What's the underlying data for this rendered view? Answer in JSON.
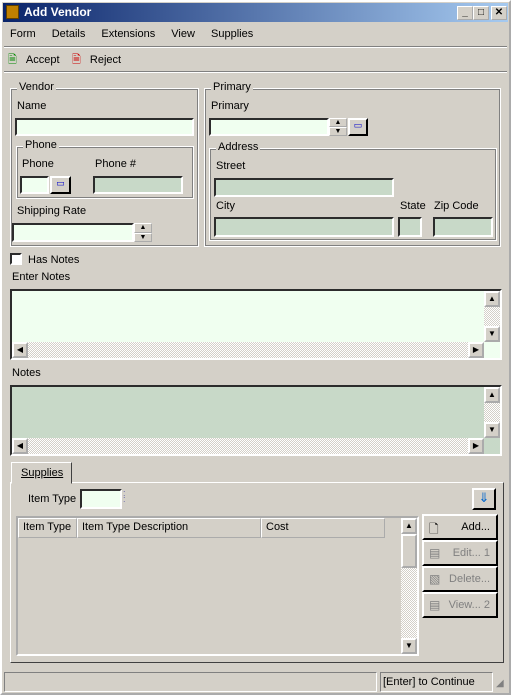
{
  "window": {
    "title": "Add Vendor",
    "min": "_",
    "max": "□",
    "close": "✕"
  },
  "menu": [
    "Form",
    "Details",
    "Extensions",
    "View",
    "Supplies"
  ],
  "toolbar": {
    "accept": "Accept",
    "reject": "Reject"
  },
  "vendor": {
    "group": "Vendor",
    "name_label": "Name",
    "name_value": "",
    "phone_group": "Phone",
    "phone_label": "Phone",
    "phone_num_label": "Phone #",
    "shipping_label": "Shipping Rate"
  },
  "primary": {
    "group": "Primary",
    "primary_label": "Primary",
    "address_group": "Address",
    "street_label": "Street",
    "city_label": "City",
    "state_label": "State",
    "zip_label": "Zip Code"
  },
  "notes": {
    "has_notes_label": "Has Notes",
    "has_notes_checked": false,
    "enter_label": "Enter Notes",
    "notes_label": "Notes"
  },
  "supplies": {
    "tab": "Supplies",
    "item_type_label": "Item Type",
    "columns": [
      "Item Type",
      "Item Type Description",
      "Cost"
    ],
    "rows": [],
    "buttons": {
      "add": "Add...",
      "edit": "Edit... 1",
      "delete": "Delete...",
      "view": "View... 2"
    }
  },
  "status": {
    "left": "",
    "right": "[Enter] to Continue"
  }
}
